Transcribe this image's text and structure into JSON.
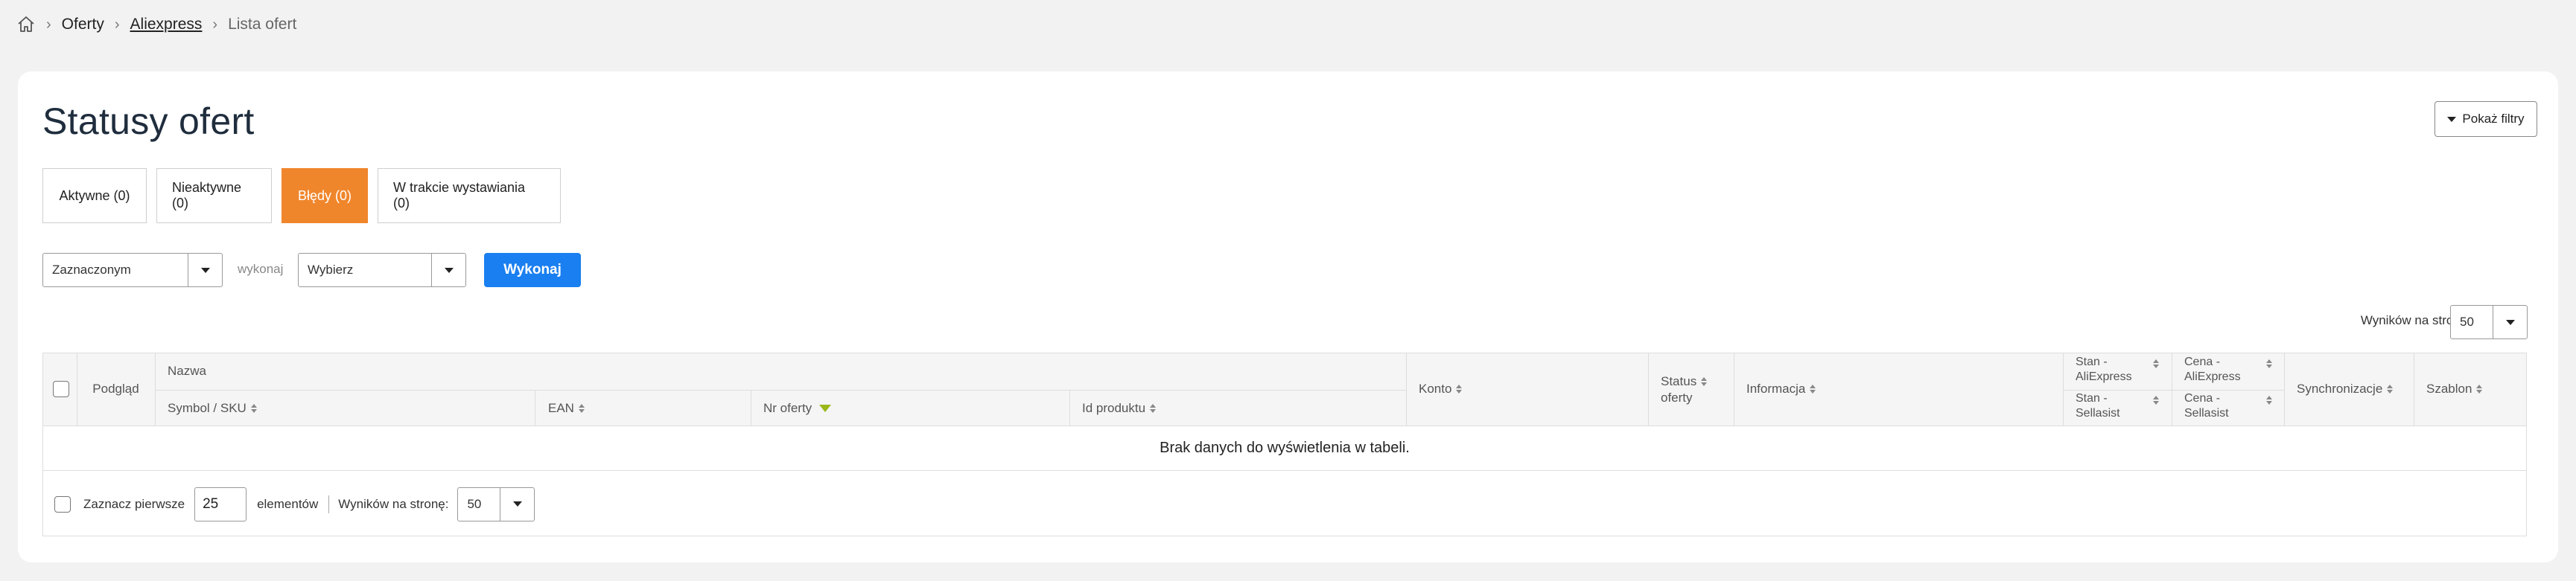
{
  "breadcrumb": {
    "items": [
      "Oferty",
      "Aliexpress",
      "Lista ofert"
    ]
  },
  "page": {
    "title": "Statusy ofert",
    "show_filters_label": "Pokaż filtry"
  },
  "tabs": [
    {
      "label": "Aktywne (0)",
      "active": false
    },
    {
      "label": "Nieaktywne (0)",
      "active": false
    },
    {
      "label": "Błędy (0)",
      "active": true
    },
    {
      "label": "W trakcie wystawiania (0)",
      "active": false
    }
  ],
  "actions": {
    "scope_value": "Zaznaczonym",
    "execute_label": "wykonaj",
    "action_value": "Wybierz",
    "execute_button": "Wykonaj"
  },
  "pagination_top": {
    "label": "Wyników na stronę:",
    "value": "50"
  },
  "table": {
    "headers": {
      "preview": "Podgląd",
      "name": "Nazwa",
      "symbol": "Symbol / SKU",
      "ean": "EAN",
      "offer_no": "Nr oferty",
      "product_id": "Id produktu",
      "account": "Konto",
      "status_line1": "Status",
      "status_line2": "oferty",
      "info": "Informacja",
      "stock_ali_1": "Stan -",
      "stock_ali_2": "AliExpress",
      "stock_sel_1": "Stan -",
      "stock_sel_2": "Sellasist",
      "price_ali_1": "Cena -",
      "price_ali_2": "AliExpress",
      "price_sel_1": "Cena -",
      "price_sel_2": "Sellasist",
      "sync": "Synchronizacje",
      "template": "Szablon"
    },
    "empty_message": "Brak danych do wyświetlenia w tabeli."
  },
  "footer": {
    "select_first_label": "Zaznacz pierwsze",
    "select_first_value": "25",
    "elements_label": "elementów",
    "per_page_label": "Wyników na stronę:",
    "per_page_value": "50"
  },
  "colors": {
    "accent_orange": "#f0862c",
    "primary_blue": "#1a7ff0",
    "sort_active": "#9bb81a"
  }
}
